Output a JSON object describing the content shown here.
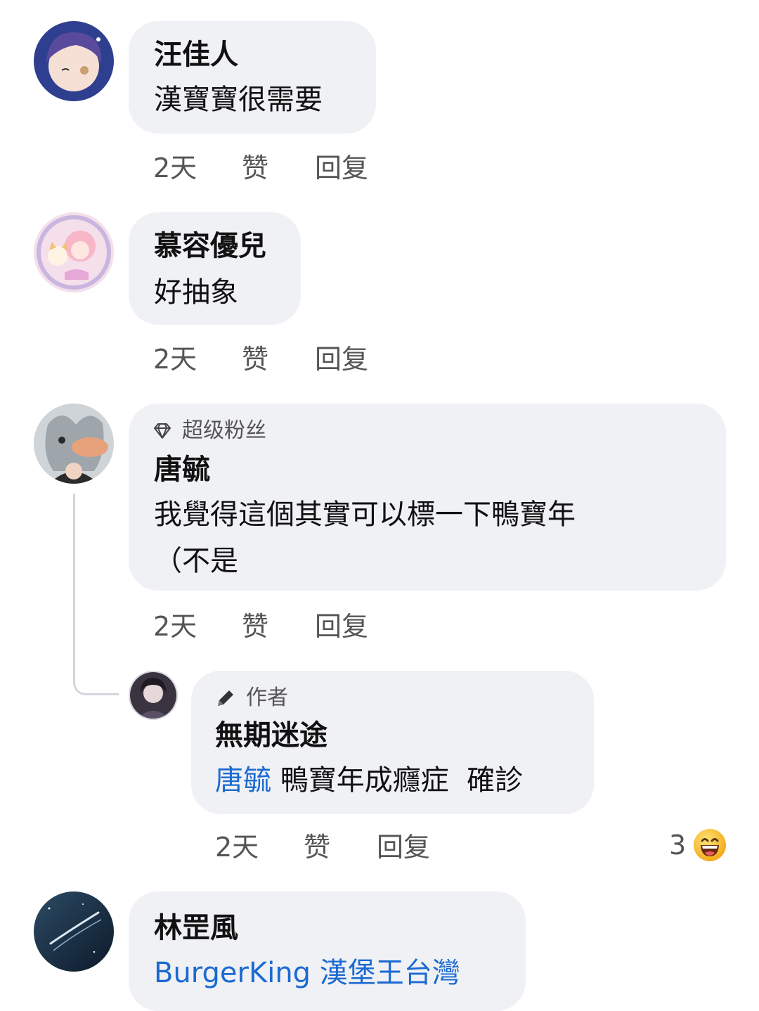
{
  "comments": [
    {
      "name": "汪佳人",
      "text": "漢寶寶很需要",
      "time": "2天",
      "like": "赞",
      "reply": "回复"
    },
    {
      "name": "慕容優兒",
      "text": "好抽象",
      "time": "2天",
      "like": "赞",
      "reply": "回复"
    },
    {
      "badge": "超级粉丝",
      "badge_icon": "diamond-icon",
      "name": "唐毓",
      "text_line1": "我覺得這個其實可以標一下鴨寶年",
      "text_line2": "（不是",
      "time": "2天",
      "like": "赞",
      "reply": "回复"
    },
    {
      "name": "林罡風",
      "link_text": "BurgerKing 漢堡王台灣"
    }
  ],
  "reply": {
    "badge": "作者",
    "badge_icon": "pencil-icon",
    "name": "無期迷途",
    "mention": "唐毓",
    "text": "鴨寶年成癮症  確診",
    "time": "2天",
    "like": "赞",
    "reply": "回复",
    "reaction_count": "3",
    "reaction_icon": "grinning-face-emoji-icon"
  },
  "colors": {
    "bubble": "#f0f1f5",
    "mention": "#1a6ad1",
    "action_text": "#555555"
  }
}
